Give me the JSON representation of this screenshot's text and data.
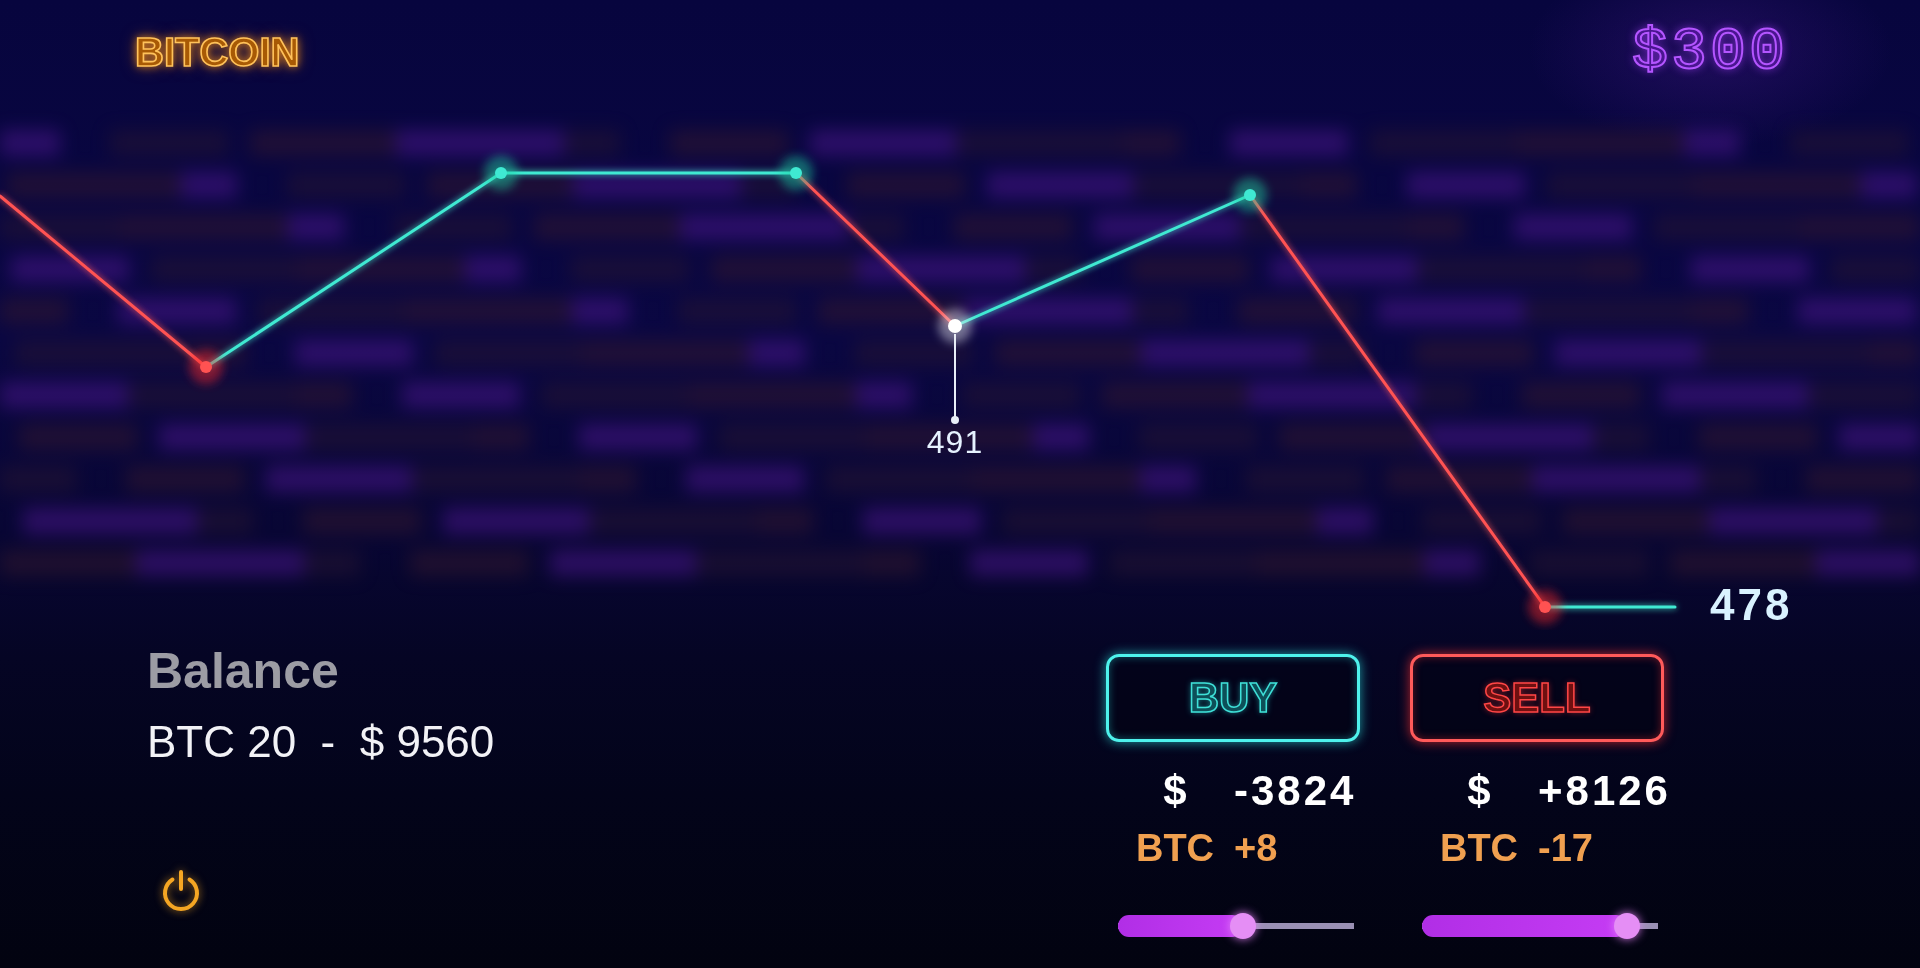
{
  "header": {
    "logo": "BITCOIN",
    "price": "$300"
  },
  "chart": {
    "highlight_label": "491",
    "last_value": "478"
  },
  "balance": {
    "title": "Balance",
    "value": "BTC 20  -  $ 9560"
  },
  "trades": [
    {
      "kind": "buy",
      "label": "BUY",
      "usd_label": "$",
      "usd_value": "-3824",
      "btc_label": "BTC",
      "btc_value": "+8",
      "level": 0.53
    },
    {
      "kind": "sell",
      "label": "SELL",
      "usd_label": "$",
      "usd_value": "+8126",
      "btc_label": "BTC",
      "btc_value": "-17",
      "level": 0.87
    }
  ]
}
